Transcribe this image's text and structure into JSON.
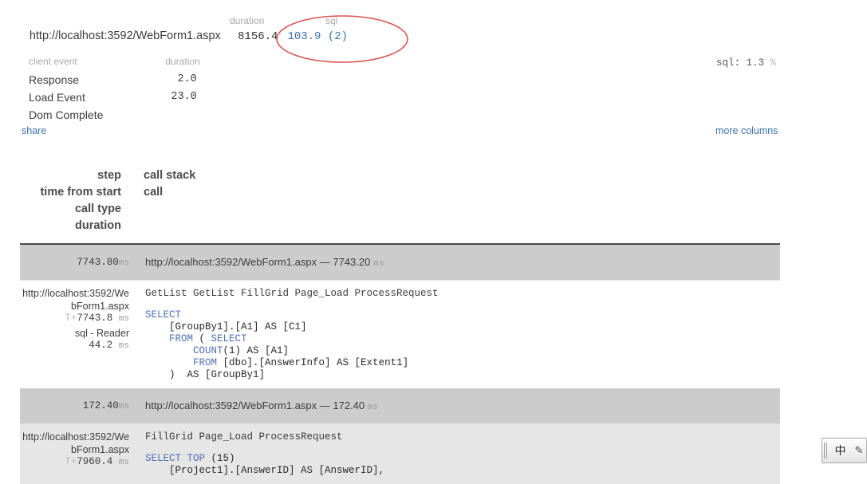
{
  "summary": {
    "url": "http://localhost:3592/WebForm1.aspx",
    "duration_label": "duration",
    "duration_value": "8156.4",
    "sql_label": "sql",
    "sql_value": "103.9 (2)",
    "sql_percent": "sql: 1.3",
    "sql_percent_sign": "%",
    "share_label": "share",
    "more_columns_label": "more columns",
    "annotation": {
      "shape": "ellipse",
      "color": "#d9534f",
      "target": "sql_value"
    }
  },
  "client_events": {
    "headers": [
      "client event",
      "duration"
    ],
    "rows": [
      {
        "name": "Response",
        "duration": "2.0"
      },
      {
        "name": "Load Event",
        "duration": "23.0"
      },
      {
        "name": "Dom Complete",
        "duration": ""
      }
    ]
  },
  "column_key": {
    "left": [
      "step",
      "time from start",
      "call type",
      "duration"
    ],
    "right": [
      "call stack",
      "call"
    ]
  },
  "trace": {
    "groups": [
      {
        "time": "7743.80",
        "time_unit": "ms",
        "title_url": "http://localhost:3592/WebForm1.aspx",
        "title_sep": "—",
        "title_time": "7743.20",
        "title_unit": "ms",
        "rows": [
          {
            "highlighted": false,
            "step_url": "http://localhost:3592/WebForm1.aspx",
            "time_from_start_prefix": "T+",
            "time_from_start": "7743.8",
            "time_unit": "ms",
            "call_type": "sql - Reader",
            "duration": "44.2",
            "duration_unit": "ms",
            "call_stack": "GetList GetList FillGrid Page_Load ProcessRequest",
            "sql_tokens": [
              {
                "t": "SELECT",
                "kw": true
              },
              {
                "t": "\n    ",
                "kw": false
              },
              {
                "t": "[GroupBy1].[A1] AS [C1]",
                "kw": false
              },
              {
                "t": "\n    ",
                "kw": false
              },
              {
                "t": "FROM",
                "kw": true
              },
              {
                "t": " ( ",
                "kw": false
              },
              {
                "t": "SELECT",
                "kw": true
              },
              {
                "t": "\n        ",
                "kw": false
              },
              {
                "t": "COUNT",
                "kw": true
              },
              {
                "t": "(1) AS [A1]",
                "kw": false
              },
              {
                "t": "\n        ",
                "kw": false
              },
              {
                "t": "FROM",
                "kw": true
              },
              {
                "t": " [dbo].[AnswerInfo] AS [Extent1]",
                "kw": false
              },
              {
                "t": "\n    )  AS [GroupBy1]",
                "kw": false
              }
            ]
          }
        ]
      },
      {
        "time": "172.40",
        "time_unit": "ms",
        "title_url": "http://localhost:3592/WebForm1.aspx",
        "title_sep": "—",
        "title_time": "172.40",
        "title_unit": "ms",
        "rows": [
          {
            "highlighted": true,
            "step_url": "http://localhost:3592/WebForm1.aspx",
            "time_from_start_prefix": "T+",
            "time_from_start": "7960.4",
            "time_unit": "ms",
            "call_type": "",
            "duration": "",
            "duration_unit": "",
            "call_stack": "FillGrid Page_Load ProcessRequest",
            "sql_tokens": [
              {
                "t": "SELECT",
                "kw": true
              },
              {
                "t": " ",
                "kw": false
              },
              {
                "t": "TOP",
                "kw": true
              },
              {
                "t": " (15)",
                "kw": false
              },
              {
                "t": "\n    [Project1].[AnswerID] AS [AnswerID],",
                "kw": false
              }
            ]
          }
        ]
      }
    ]
  },
  "ime_bar": {
    "language": "中",
    "pen_icon": "✎"
  }
}
